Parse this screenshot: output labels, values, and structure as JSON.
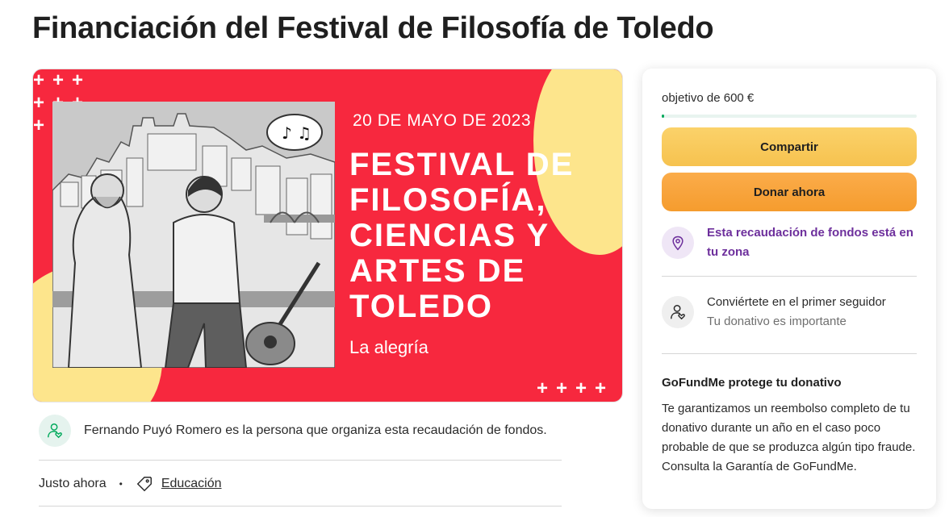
{
  "page": {
    "title": "Financiación del Festival de Filosofía de Toledo"
  },
  "hero": {
    "date": "20 DE MAYO DE 2023",
    "title_lines": [
      "FESTIVAL DE",
      "FILOSOFÍA,",
      "CIENCIAS Y",
      "ARTES DE",
      "TOLEDO"
    ],
    "subtitle": "La alegría",
    "plus_top": "+++\n+++\n+++",
    "plus_bottom": "++++",
    "colors": {
      "background": "#f7283e",
      "blob": "#fde58c"
    }
  },
  "organizer": {
    "icon": "user-heart-icon",
    "text": "Fernando Puyó Romero es la persona que organiza esta recaudación de fondos."
  },
  "meta": {
    "time": "Justo ahora",
    "separator": "•",
    "category_icon": "tag-icon",
    "category": "Educación"
  },
  "sidebar": {
    "goal": "objetivo de 600 €",
    "progress_fraction": 0.01,
    "share_label": "Compartir",
    "donate_label": "Donar ahora",
    "zone": {
      "icon": "location-pin-icon",
      "text": "Esta recaudación de fondos está en tu zona"
    },
    "follow": {
      "icon": "user-heart-icon",
      "title": "Conviértete en el primer seguidor",
      "subtitle": "Tu donativo es importante"
    },
    "protect": {
      "title": "GoFundMe protege tu donativo",
      "text": "Te garantizamos un reembolso completo de tu donativo durante un año en el caso poco probable de que se produzca algún tipo fraude. Consulta la Garantía de GoFundMe."
    },
    "colors": {
      "share": "#f6c24f",
      "donate": "#f59c2e",
      "zone_text": "#6d2f9c",
      "progress": "#02a95c"
    }
  }
}
